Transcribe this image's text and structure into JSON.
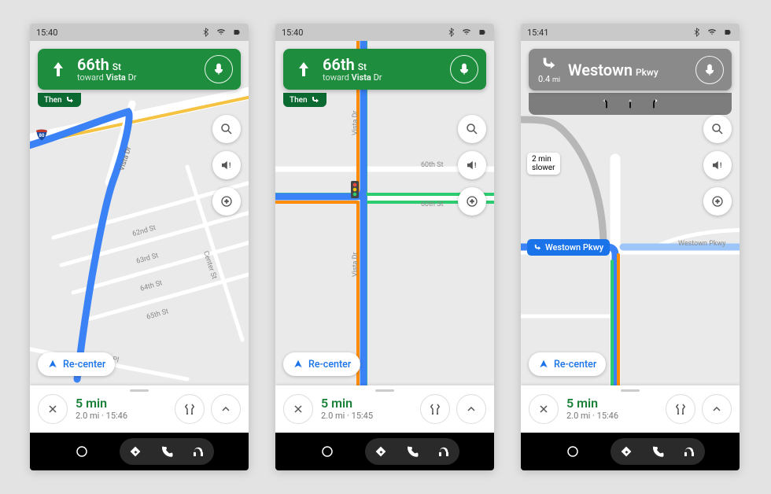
{
  "status": {
    "time_1": "15:40",
    "time_2": "15:40",
    "time_3": "15:41"
  },
  "nav1": {
    "street_main": "66th",
    "street_suffix": "St",
    "toward_label": "toward",
    "toward_dest_main": "Vista",
    "toward_dest_suffix": "Dr",
    "then_label": "Then"
  },
  "nav2": {
    "street_main": "66th",
    "street_suffix": "St",
    "toward_label": "toward",
    "toward_dest_main": "Vista",
    "toward_dest_suffix": "Dr",
    "then_label": "Then"
  },
  "nav3": {
    "distance": "0.4",
    "distance_unit": "mi",
    "street_main": "Westown",
    "street_suffix": "Pkwy"
  },
  "map_labels_1": [
    "62nd St",
    "63rd St",
    "64th St",
    "65th St",
    "Center St",
    "th Pl"
  ],
  "map_labels_2": [
    "60th St",
    "60th St",
    "Vista Dr",
    "Vista Dr"
  ],
  "map_labels_3": [
    "Westown Pkwy",
    "Westown Pkwy"
  ],
  "traffic_chip_3": "2 min\nslower",
  "route_bubble_3": "Westown Pkwy",
  "recenter_label": "Re-center",
  "sheets": {
    "1": {
      "time": "5 min",
      "meta": "2.0 mi · 15:46"
    },
    "2": {
      "time": "5 min",
      "meta": "2.0 mi · 15:45"
    },
    "3": {
      "time": "5 min",
      "meta": "2.0 mi · 15:46"
    }
  }
}
